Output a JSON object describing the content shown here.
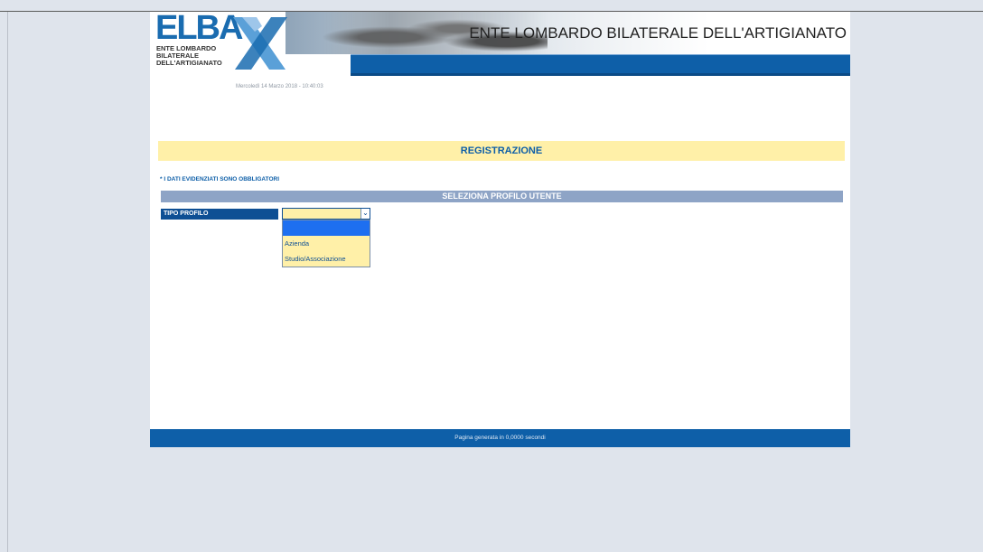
{
  "header": {
    "logo_text": "ELBA",
    "logo_sub": [
      "ENTE LOMBARDO",
      "BILATERALE",
      "DELL'ARTIGIANATO"
    ],
    "title": "ENTE LOMBARDO BILATERALE DELL'ARTIGIANATO"
  },
  "date_text": "Mercoledì 14 Marzo 2018 - 10:40:03",
  "registration": {
    "title": "REGISTRAZIONE"
  },
  "notice": "* I DATI EVIDENZIATI SONO OBBLIGATORI",
  "profile_section": {
    "title": "SELEZIONA PROFILO UTENTE",
    "field_label": "TIPO PROFILO",
    "selected_value": "",
    "options": [
      "",
      "Azienda",
      "Studio/Associazione"
    ]
  },
  "footer": {
    "text": "Pagina generata in 0,0000 secondi"
  },
  "colors": {
    "brand_blue": "#0e5fa8",
    "highlight_yellow": "#fff0a8",
    "section_blue": "#8ea4c6"
  }
}
